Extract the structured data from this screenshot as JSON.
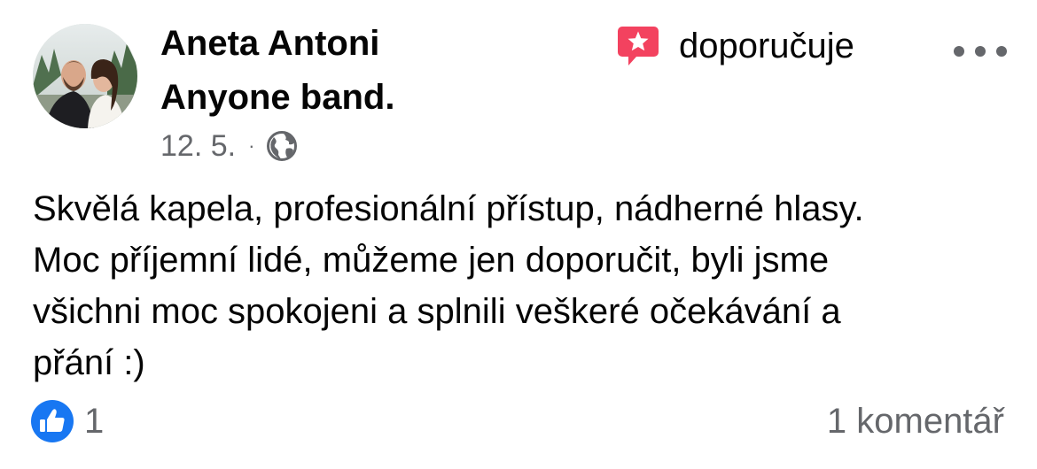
{
  "post": {
    "author": "Aneta Antoni",
    "action": "doporučuje",
    "page": "Anyone band.",
    "date": "12. 5.",
    "separator": "·",
    "audience_icon": "globe-icon",
    "recommend_icon": "recommend-star-icon",
    "more_icon": "more-options-icon",
    "text_lines": [
      "Skvělá kapela, profesionální přístup, nádherné hlasy.",
      "Moc příjemní lidé, můžeme jen doporučit, byli jsme",
      "všichni moc spokojeni a splnili veškeré očekávání a",
      "přání :)"
    ],
    "likes_count": "1",
    "comments_label": "1 komentář"
  },
  "colors": {
    "text_primary": "#050505",
    "text_secondary": "#65676b",
    "recommend_red": "#f3425f",
    "like_blue": "#1877f2"
  }
}
